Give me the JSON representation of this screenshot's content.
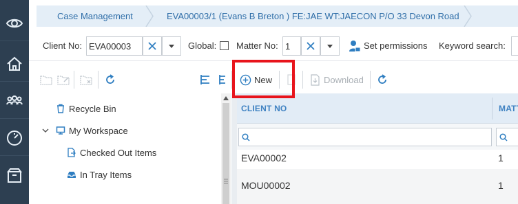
{
  "breadcrumb": {
    "case_management": "Case Management",
    "matter": "EVA00003/1 (Evans B Breton ) FE:JAE WT:JAECON P/O 33 Devon Road"
  },
  "toolbar": {
    "client_no_label": "Client No:",
    "client_no_value": "EVA00003",
    "global_label": "Global:",
    "matter_no_label": "Matter No:",
    "matter_no_value": "1",
    "set_permissions_label": "Set permissions",
    "keyword_search_label": "Keyword search:"
  },
  "doc_toolbar": {
    "new_label": "New",
    "download_label": "Download"
  },
  "tree": {
    "items": [
      {
        "label": "Recycle Bin",
        "icon": "trash-icon"
      },
      {
        "label": "My Workspace",
        "icon": "workspace-icon"
      },
      {
        "label": "Checked Out Items",
        "icon": "checked-out-icon"
      },
      {
        "label": "In Tray Items",
        "icon": "in-tray-icon"
      }
    ]
  },
  "grid": {
    "columns": [
      "CLIENT NO",
      "MATT"
    ],
    "rows": [
      {
        "client_no": "EVA00002",
        "matter": "1"
      },
      {
        "client_no": "MOU00002",
        "matter": "1"
      }
    ]
  },
  "nav_icons": [
    "eye-icon",
    "home-icon",
    "people-icon",
    "clock-icon",
    "archive-icon"
  ],
  "colors": {
    "sidebar": "#2d3f51",
    "accent": "#2f6ea8",
    "highlight": "#e8141c"
  }
}
